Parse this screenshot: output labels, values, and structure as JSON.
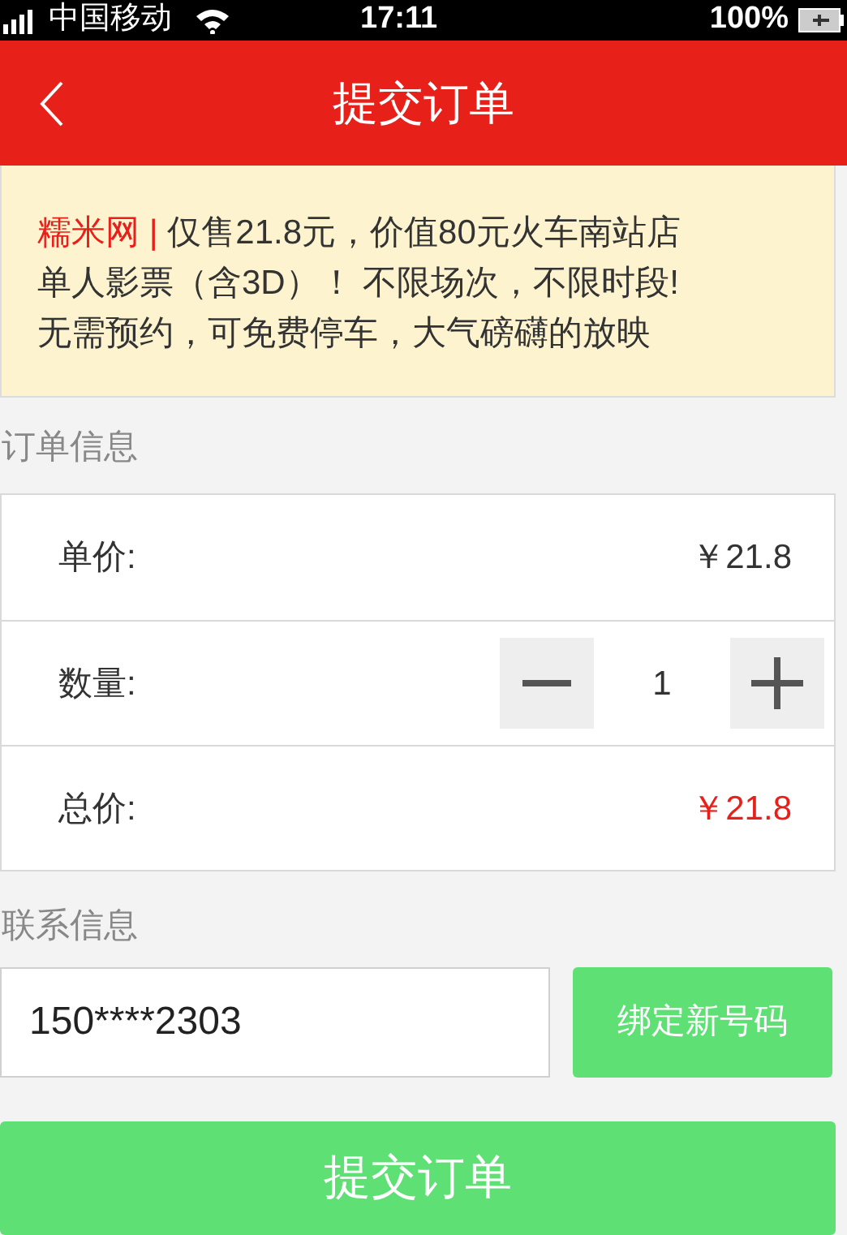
{
  "status_bar": {
    "carrier": "中国移动",
    "time": "17:11",
    "battery": "100%"
  },
  "header": {
    "title": "提交订单"
  },
  "notice": {
    "source": "糯米网 |",
    "lines": [
      "仅售21.8元，价值80元火车南站店",
      "单人影票（含3D）！ 不限场次，不限时段!",
      "无需预约，可免费停车，大气磅礴的放映"
    ]
  },
  "order_section": {
    "title": "订单信息",
    "rows": [
      {
        "kind": "price",
        "label": "单价:",
        "value": "￥21.8"
      },
      {
        "kind": "stepper",
        "label": "数量:",
        "value": "1"
      },
      {
        "kind": "total",
        "label": "总价:",
        "value": "￥21.8"
      }
    ]
  },
  "contact_section": {
    "title": "联系信息",
    "phone": "150****2303",
    "bind_button": "绑定新号码"
  },
  "submit_button": "提交订单"
}
